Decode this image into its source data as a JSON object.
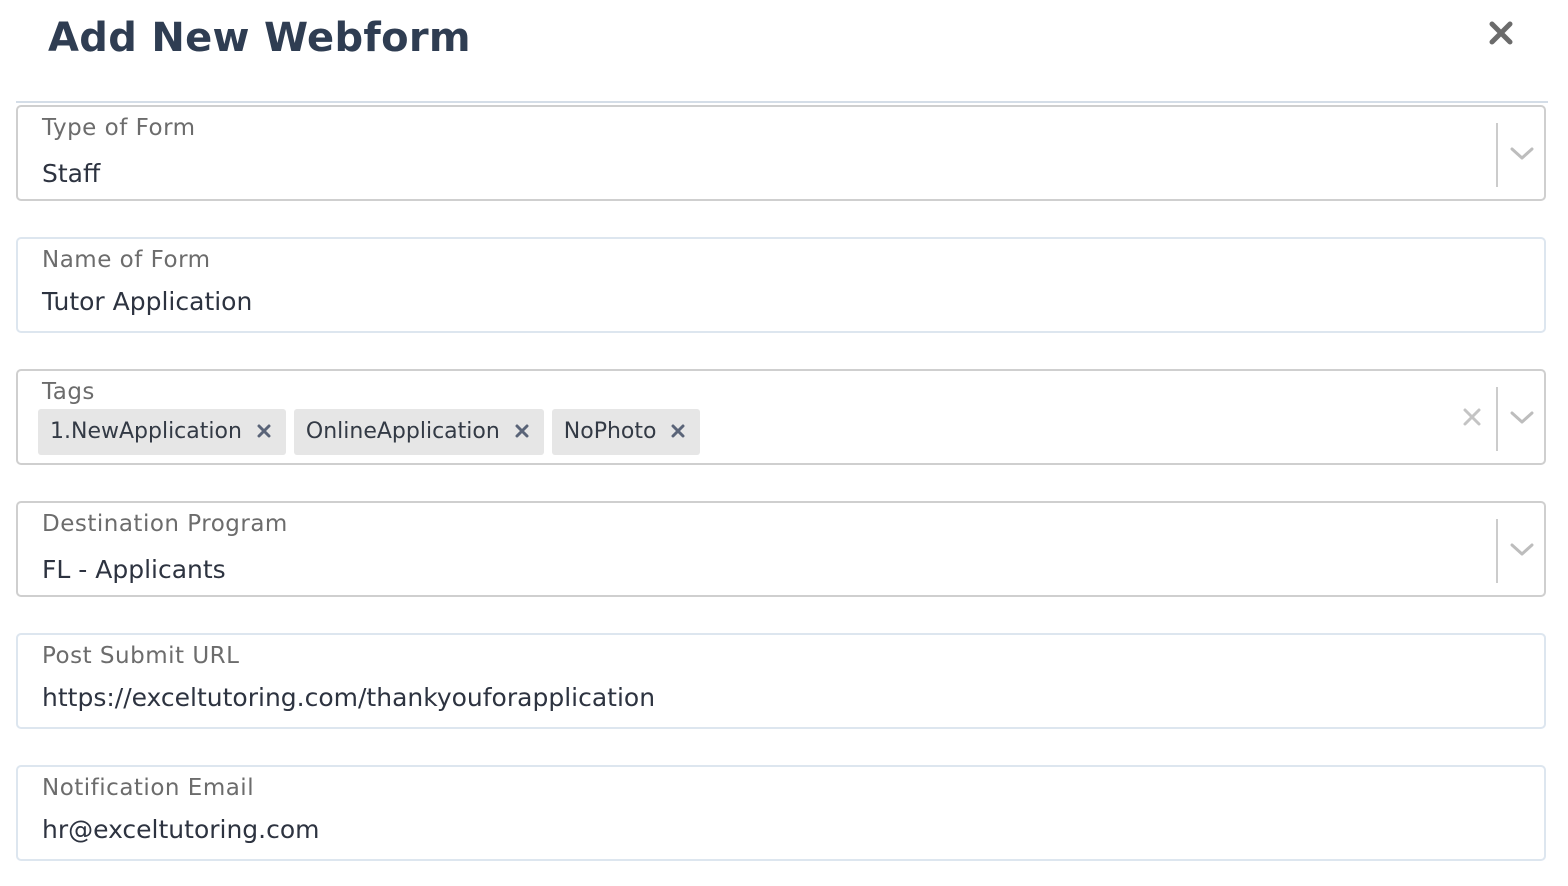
{
  "modal": {
    "title": "Add New Webform"
  },
  "form": {
    "type_of_form": {
      "label": "Type of Form",
      "value": "Staff"
    },
    "name_of_form": {
      "label": "Name of Form",
      "value": "Tutor Application"
    },
    "tags": {
      "label": "Tags",
      "items": [
        {
          "label": "1.NewApplication"
        },
        {
          "label": "OnlineApplication"
        },
        {
          "label": "NoPhoto"
        }
      ]
    },
    "destination_program": {
      "label": "Destination Program",
      "value": "FL - Applicants"
    },
    "post_submit_url": {
      "label": "Post Submit URL",
      "value": "https://exceltutoring.com/thankyouforapplication"
    },
    "notification_email": {
      "label": "Notification Email",
      "value": "hr@exceltutoring.com"
    }
  },
  "icons": {
    "close": "close-icon",
    "chevron": "chevron-down-icon",
    "clear": "clear-icon",
    "tag_remove": "remove-tag-icon"
  },
  "colors": {
    "title": "#2f3d52",
    "label": "#6c6c6c",
    "tag_background": "#e6e6e6",
    "tag_remove": "#5a6478"
  }
}
